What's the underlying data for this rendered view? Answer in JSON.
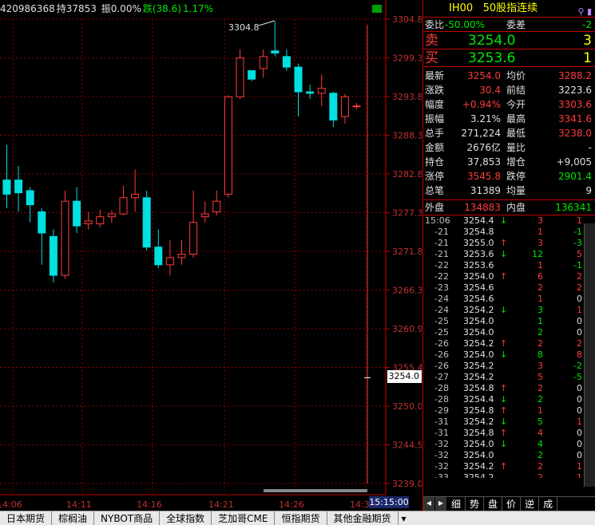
{
  "top_info": {
    "volume_part": "420986368",
    "hold_label": "持37853",
    "amp_label": "振0.00%",
    "fall_label": "跌(38.6)",
    "fall_pct": "1.17%"
  },
  "chart_data": {
    "type": "candlestick",
    "y_ticks": [
      "3304.8",
      "3299.3",
      "3293.8",
      "3288.3",
      "3282.8",
      "3277.3",
      "3271.8",
      "3266.3",
      "3260.9",
      "3255.4",
      "3250.0",
      "3244.5",
      "3239.0"
    ],
    "x_ticks": [
      "14:06",
      "14:11",
      "14:16",
      "14:21",
      "14:26",
      "14:31"
    ],
    "ylim": [
      3239.0,
      3304.8
    ],
    "high_annotation": "3304.8",
    "current_price": "3254.0",
    "current_time": "15:15:00",
    "candles": [
      {
        "o": 3282.0,
        "c": 3280.0,
        "h": 3287.0,
        "l": 3278.0
      },
      {
        "o": 3282.0,
        "c": 3280.2,
        "h": 3284.0,
        "l": 3277.5
      },
      {
        "o": 3280.5,
        "c": 3278.5,
        "h": 3281.0,
        "l": 3276.0
      },
      {
        "o": 3277.5,
        "c": 3274.5,
        "h": 3278.0,
        "l": 3270.0
      },
      {
        "o": 3274.0,
        "c": 3268.5,
        "h": 3275.0,
        "l": 3267.5
      },
      {
        "o": 3268.5,
        "c": 3279.0,
        "h": 3280.5,
        "l": 3268.0
      },
      {
        "o": 3279.0,
        "c": 3275.5,
        "h": 3281.0,
        "l": 3274.5
      },
      {
        "o": 3275.8,
        "c": 3276.2,
        "h": 3277.5,
        "l": 3275.0
      },
      {
        "o": 3275.8,
        "c": 3276.8,
        "h": 3277.8,
        "l": 3275.3
      },
      {
        "o": 3276.8,
        "c": 3277.2,
        "h": 3277.7,
        "l": 3276.0
      },
      {
        "o": 3277.2,
        "c": 3279.5,
        "h": 3281.2,
        "l": 3277.0
      },
      {
        "o": 3279.5,
        "c": 3280.0,
        "h": 3283.5,
        "l": 3277.5
      },
      {
        "o": 3279.5,
        "c": 3272.5,
        "h": 3280.5,
        "l": 3272.0
      },
      {
        "o": 3272.5,
        "c": 3270.0,
        "h": 3275.0,
        "l": 3269.5
      },
      {
        "o": 3270.0,
        "c": 3271.0,
        "h": 3273.5,
        "l": 3268.5
      },
      {
        "o": 3271.0,
        "c": 3271.5,
        "h": 3273.5,
        "l": 3270.0
      },
      {
        "o": 3271.5,
        "c": 3276.0,
        "h": 3280.5,
        "l": 3271.0
      },
      {
        "o": 3276.8,
        "c": 3277.2,
        "h": 3279.0,
        "l": 3276.0
      },
      {
        "o": 3277.5,
        "c": 3279.0,
        "h": 3280.5,
        "l": 3277.0
      },
      {
        "o": 3280.0,
        "c": 3293.8,
        "h": 3294.0,
        "l": 3279.5
      },
      {
        "o": 3293.8,
        "c": 3299.3,
        "h": 3300.5,
        "l": 3293.5
      },
      {
        "o": 3297.5,
        "c": 3296.3,
        "h": 3297.5,
        "l": 3296.0
      },
      {
        "o": 3297.8,
        "c": 3299.5,
        "h": 3300.5,
        "l": 3296.5
      },
      {
        "o": 3300.3,
        "c": 3300.0,
        "h": 3304.5,
        "l": 3299.5
      },
      {
        "o": 3299.5,
        "c": 3298.0,
        "h": 3300.5,
        "l": 3297.5
      },
      {
        "o": 3298.0,
        "c": 3294.5,
        "h": 3298.5,
        "l": 3291.0
      },
      {
        "o": 3294.5,
        "c": 3294.3,
        "h": 3295.5,
        "l": 3293.5
      },
      {
        "o": 3294.3,
        "c": 3295.0,
        "h": 3297.0,
        "l": 3292.5
      },
      {
        "o": 3294.3,
        "c": 3290.5,
        "h": 3294.5,
        "l": 3289.5
      },
      {
        "o": 3291.0,
        "c": 3293.8,
        "h": 3294.2,
        "l": 3290.0
      },
      {
        "o": 3292.5,
        "c": 3292.5,
        "h": 3292.9,
        "l": 3292.0
      },
      {
        "o": 3254.0,
        "c": 3254.0,
        "h": 3304.0,
        "l": 3239.0
      }
    ]
  },
  "panel": {
    "code": "IH00",
    "name": "50股指连续",
    "weibi_label": "委比",
    "weibi_value": "-50.00%",
    "weicha_label": "委差",
    "weicha_value": "-2",
    "sell_label": "卖",
    "sell_price": "3254.0",
    "sell_qty": "3",
    "buy_label": "买",
    "buy_price": "3253.6",
    "buy_qty": "1",
    "stats": [
      {
        "l1": "最新",
        "v1": "3254.0",
        "c1": "red",
        "l2": "均价",
        "v2": "3288.2",
        "c2": "red"
      },
      {
        "l1": "涨跌",
        "v1": "30.4",
        "c1": "red",
        "l2": "前结",
        "v2": "3223.6",
        "c2": "white"
      },
      {
        "l1": "幅度",
        "v1": "+0.94%",
        "c1": "red",
        "l2": "今开",
        "v2": "3303.6",
        "c2": "red"
      },
      {
        "l1": "振幅",
        "v1": "3.21%",
        "c1": "white",
        "l2": "最高",
        "v2": "3341.6",
        "c2": "red"
      },
      {
        "l1": "总手",
        "v1": "271,224",
        "c1": "white",
        "l2": "最低",
        "v2": "3238.0",
        "c2": "red"
      },
      {
        "l1": "金额",
        "v1": "2676亿",
        "c1": "white",
        "l2": "量比",
        "v2": "-",
        "c2": "white"
      },
      {
        "l1": "持仓",
        "v1": "37,853",
        "c1": "white",
        "l2": "增仓",
        "v2": "+9,005",
        "c2": "white"
      },
      {
        "l1": "涨停",
        "v1": "3545.8",
        "c1": "red",
        "l2": "跌停",
        "v2": "2901.4",
        "c2": "green"
      },
      {
        "l1": "总笔",
        "v1": "31389",
        "c1": "white",
        "l2": "均量",
        "v2": "9",
        "c2": "white"
      }
    ],
    "outer_label": "外盘",
    "outer_value": "134883",
    "inner_label": "内盘",
    "inner_value": "136341",
    "ticks": [
      {
        "t": "15:06",
        "p": "3254.4",
        "a": "↓",
        "ac": "green",
        "pc": "white",
        "q": "3",
        "qc": "red",
        "d": "1",
        "dc": "red"
      },
      {
        "t": "-21",
        "p": "3254.8",
        "a": "",
        "ac": "",
        "pc": "white",
        "q": "1",
        "qc": "red",
        "d": "-1",
        "dc": "green"
      },
      {
        "t": "-21",
        "p": "3255.0",
        "a": "↑",
        "ac": "red",
        "pc": "white",
        "q": "3",
        "qc": "red",
        "d": "-3",
        "dc": "green"
      },
      {
        "t": "-21",
        "p": "3253.6",
        "a": "↓",
        "ac": "green",
        "pc": "white",
        "q": "12",
        "qc": "green",
        "d": "5",
        "dc": "red"
      },
      {
        "t": "-22",
        "p": "3253.6",
        "a": "",
        "ac": "",
        "pc": "white",
        "q": "1",
        "qc": "red",
        "d": "-1",
        "dc": "green"
      },
      {
        "t": "-22",
        "p": "3254.0",
        "a": "↑",
        "ac": "red",
        "pc": "white",
        "q": "6",
        "qc": "red",
        "d": "2",
        "dc": "red"
      },
      {
        "t": "-23",
        "p": "3254.6",
        "a": "",
        "ac": "",
        "pc": "white",
        "q": "2",
        "qc": "red",
        "d": "2",
        "dc": "red"
      },
      {
        "t": "-24",
        "p": "3254.6",
        "a": "",
        "ac": "",
        "pc": "white",
        "q": "1",
        "qc": "red",
        "d": "0",
        "dc": "white"
      },
      {
        "t": "-24",
        "p": "3254.2",
        "a": "↓",
        "ac": "green",
        "pc": "white",
        "q": "3",
        "qc": "green",
        "d": "1",
        "dc": "red"
      },
      {
        "t": "-25",
        "p": "3254.0",
        "a": "",
        "ac": "",
        "pc": "white",
        "q": "1",
        "qc": "green",
        "d": "0",
        "dc": "white"
      },
      {
        "t": "-25",
        "p": "3254.0",
        "a": "",
        "ac": "",
        "pc": "white",
        "q": "2",
        "qc": "green",
        "d": "0",
        "dc": "white"
      },
      {
        "t": "-26",
        "p": "3254.2",
        "a": "↑",
        "ac": "red",
        "pc": "white",
        "q": "2",
        "qc": "red",
        "d": "2",
        "dc": "red"
      },
      {
        "t": "-26",
        "p": "3254.0",
        "a": "↓",
        "ac": "green",
        "pc": "white",
        "q": "8",
        "qc": "green",
        "d": "8",
        "dc": "red"
      },
      {
        "t": "-26",
        "p": "3254.2",
        "a": "",
        "ac": "",
        "pc": "white",
        "q": "3",
        "qc": "red",
        "d": "-2",
        "dc": "green"
      },
      {
        "t": "-27",
        "p": "3254.2",
        "a": "",
        "ac": "",
        "pc": "white",
        "q": "5",
        "qc": "red",
        "d": "-5",
        "dc": "green"
      },
      {
        "t": "-28",
        "p": "3254.8",
        "a": "↑",
        "ac": "red",
        "pc": "white",
        "q": "2",
        "qc": "red",
        "d": "0",
        "dc": "white"
      },
      {
        "t": "-28",
        "p": "3254.4",
        "a": "↓",
        "ac": "green",
        "pc": "white",
        "q": "2",
        "qc": "green",
        "d": "0",
        "dc": "white"
      },
      {
        "t": "-29",
        "p": "3254.8",
        "a": "↑",
        "ac": "red",
        "pc": "white",
        "q": "1",
        "qc": "red",
        "d": "0",
        "dc": "white"
      },
      {
        "t": "-31",
        "p": "3254.2",
        "a": "↓",
        "ac": "green",
        "pc": "white",
        "q": "5",
        "qc": "green",
        "d": "1",
        "dc": "red"
      },
      {
        "t": "-31",
        "p": "3254.8",
        "a": "↑",
        "ac": "red",
        "pc": "white",
        "q": "4",
        "qc": "red",
        "d": "0",
        "dc": "white"
      },
      {
        "t": "-32",
        "p": "3254.0",
        "a": "↓",
        "ac": "green",
        "pc": "white",
        "q": "4",
        "qc": "green",
        "d": "0",
        "dc": "white"
      },
      {
        "t": "-32",
        "p": "3254.0",
        "a": "",
        "ac": "",
        "pc": "white",
        "q": "2",
        "qc": "green",
        "d": "0",
        "dc": "white"
      },
      {
        "t": "-32",
        "p": "3254.2",
        "a": "↑",
        "ac": "red",
        "pc": "white",
        "q": "2",
        "qc": "red",
        "d": "1",
        "dc": "red"
      },
      {
        "t": "-33",
        "p": "3254.2",
        "a": "",
        "ac": "",
        "pc": "white",
        "q": "2",
        "qc": "red",
        "d": "1",
        "dc": "red"
      }
    ],
    "tabs": [
      "细",
      "势",
      "盘",
      "价",
      "逆",
      "成"
    ]
  },
  "bottom_tabs": [
    "日本期货",
    "棕榈油",
    "NYBOT商品",
    "全球指数",
    "芝加哥CME",
    "恒指期货",
    "其他金融期货"
  ],
  "colors": {
    "up": "#ff3b3b",
    "down": "#00e0e0",
    "grid": "#8b0000",
    "axis": "#c00000"
  }
}
